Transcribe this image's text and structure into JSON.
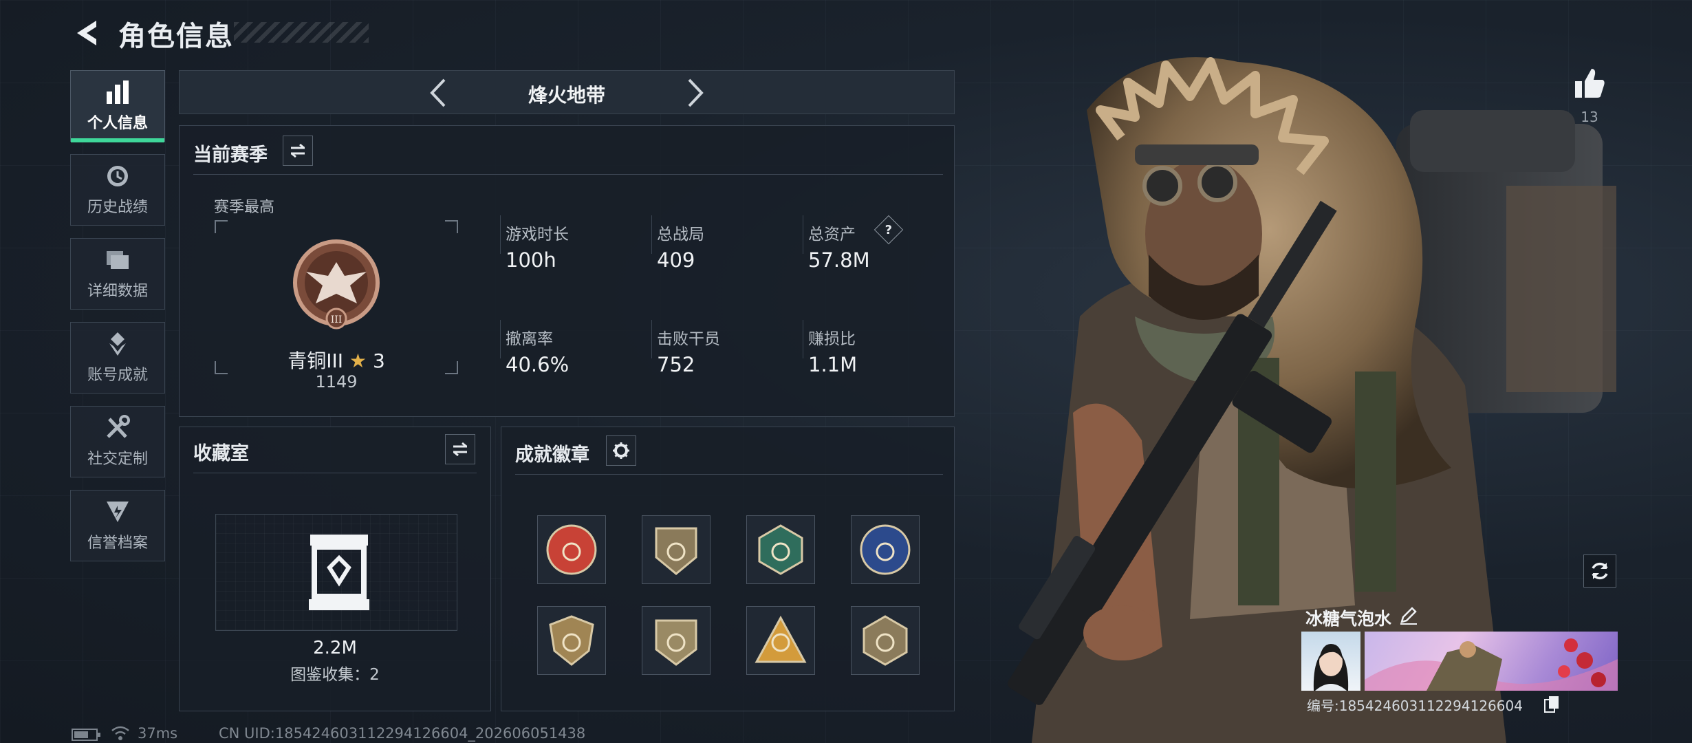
{
  "header": {
    "title": "角色信息"
  },
  "nav": [
    {
      "label": "个人信息",
      "icon": "bar-chart-icon",
      "active": true
    },
    {
      "label": "历史战绩",
      "icon": "history-clock-icon"
    },
    {
      "label": "详细数据",
      "icon": "folders-icon"
    },
    {
      "label": "账号成就",
      "icon": "achievement-icon"
    },
    {
      "label": "社交定制",
      "icon": "tools-icon"
    },
    {
      "label": "信誉档案",
      "icon": "credit-shield-icon"
    }
  ],
  "mode": {
    "title": "烽火地带"
  },
  "season": {
    "title": "当前赛季",
    "best_label": "赛季最高",
    "rank_name": "青铜III",
    "rank_stars": "3",
    "rank_score": "1149",
    "stats": [
      {
        "label": "游戏时长",
        "value": "100h"
      },
      {
        "label": "总战局",
        "value": "409"
      },
      {
        "label": "总资产",
        "value": "57.8M",
        "help": "?"
      },
      {
        "label": "撤离率",
        "value": "40.6%"
      },
      {
        "label": "击败干员",
        "value": "752"
      },
      {
        "label": "赚损比",
        "value": "1.1M"
      }
    ]
  },
  "collection": {
    "title": "收藏室",
    "value": "2.2M",
    "collect_label": "图鉴收集：2"
  },
  "badges": {
    "title": "成就徽章",
    "items": [
      {
        "name": "badge-star-medal",
        "color": "#c84236"
      },
      {
        "name": "badge-helicopter",
        "color": "#8a7a5a"
      },
      {
        "name": "badge-hornet",
        "color": "#2f6d5c"
      },
      {
        "name": "badge-globe",
        "color": "#2c4a8c"
      },
      {
        "name": "badge-shield-face",
        "color": "#a08554"
      },
      {
        "name": "badge-knife",
        "color": "#9a8a64"
      },
      {
        "name": "badge-triangle-gold",
        "color": "#d39b3b"
      },
      {
        "name": "badge-triangle-dark",
        "color": "#8b7b5b"
      }
    ]
  },
  "profile": {
    "likes": "13",
    "nickname": "冰糖气泡水",
    "id_text": "编号:18542460311229412660​4"
  },
  "status": {
    "ping": "37ms",
    "uid": "CN UID:1854246031122941266​04_202606051438"
  },
  "colors": {
    "accent": "#3fd79a"
  }
}
